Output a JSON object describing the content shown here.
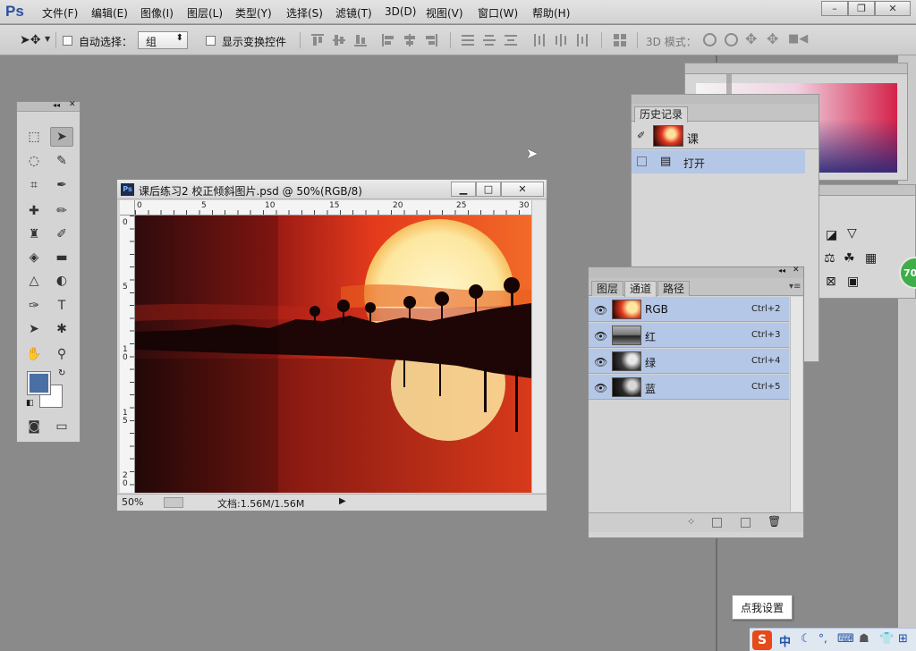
{
  "app": {
    "logo": "Ps"
  },
  "menu": [
    "文件(F)",
    "编辑(E)",
    "图像(I)",
    "图层(L)",
    "类型(Y)",
    "选择(S)",
    "滤镜(T)",
    "3D(D)",
    "视图(V)",
    "窗口(W)",
    "帮助(H)"
  ],
  "window_controls": [
    "–",
    "❐",
    "✕"
  ],
  "options_bar": {
    "auto_select_label": "自动选择：",
    "auto_select_value": "组",
    "show_transform_label": "显示变换控件",
    "mode_3d_label": "3D 模式："
  },
  "document": {
    "title": "课后练习2 校正倾斜图片.psd @ 50%(RGB/8)",
    "zoom": "50%",
    "doc_info": "文档:1.56M/1.56M",
    "hruler_ticks": [
      "0",
      "5",
      "10",
      "15",
      "20",
      "25",
      "30"
    ],
    "vruler_ticks": [
      "0",
      "5",
      "1\n0",
      "1\n5",
      "2\n0"
    ],
    "buttons": [
      "▁",
      "□",
      "✕"
    ]
  },
  "history_panel": {
    "tab": "历史记录",
    "snapshot_label": "课",
    "step_label": "打开"
  },
  "channels_panel": {
    "tabs": [
      "图层",
      "通道",
      "路径"
    ],
    "active_tab": "通道",
    "channels": [
      {
        "name": "RGB",
        "shortcut": "Ctrl+2"
      },
      {
        "name": "红",
        "shortcut": "Ctrl+3"
      },
      {
        "name": "绿",
        "shortcut": "Ctrl+4"
      },
      {
        "name": "蓝",
        "shortcut": "Ctrl+5"
      }
    ]
  },
  "badge": {
    "value": "70"
  },
  "ime": {
    "tooltip": "点我设置",
    "logo": "S",
    "lang": "中"
  },
  "colors": {
    "foreground": "#4a6fa5",
    "background": "#ffffff",
    "selection": "#b5c7e6",
    "brand": "#2c4fa0"
  }
}
